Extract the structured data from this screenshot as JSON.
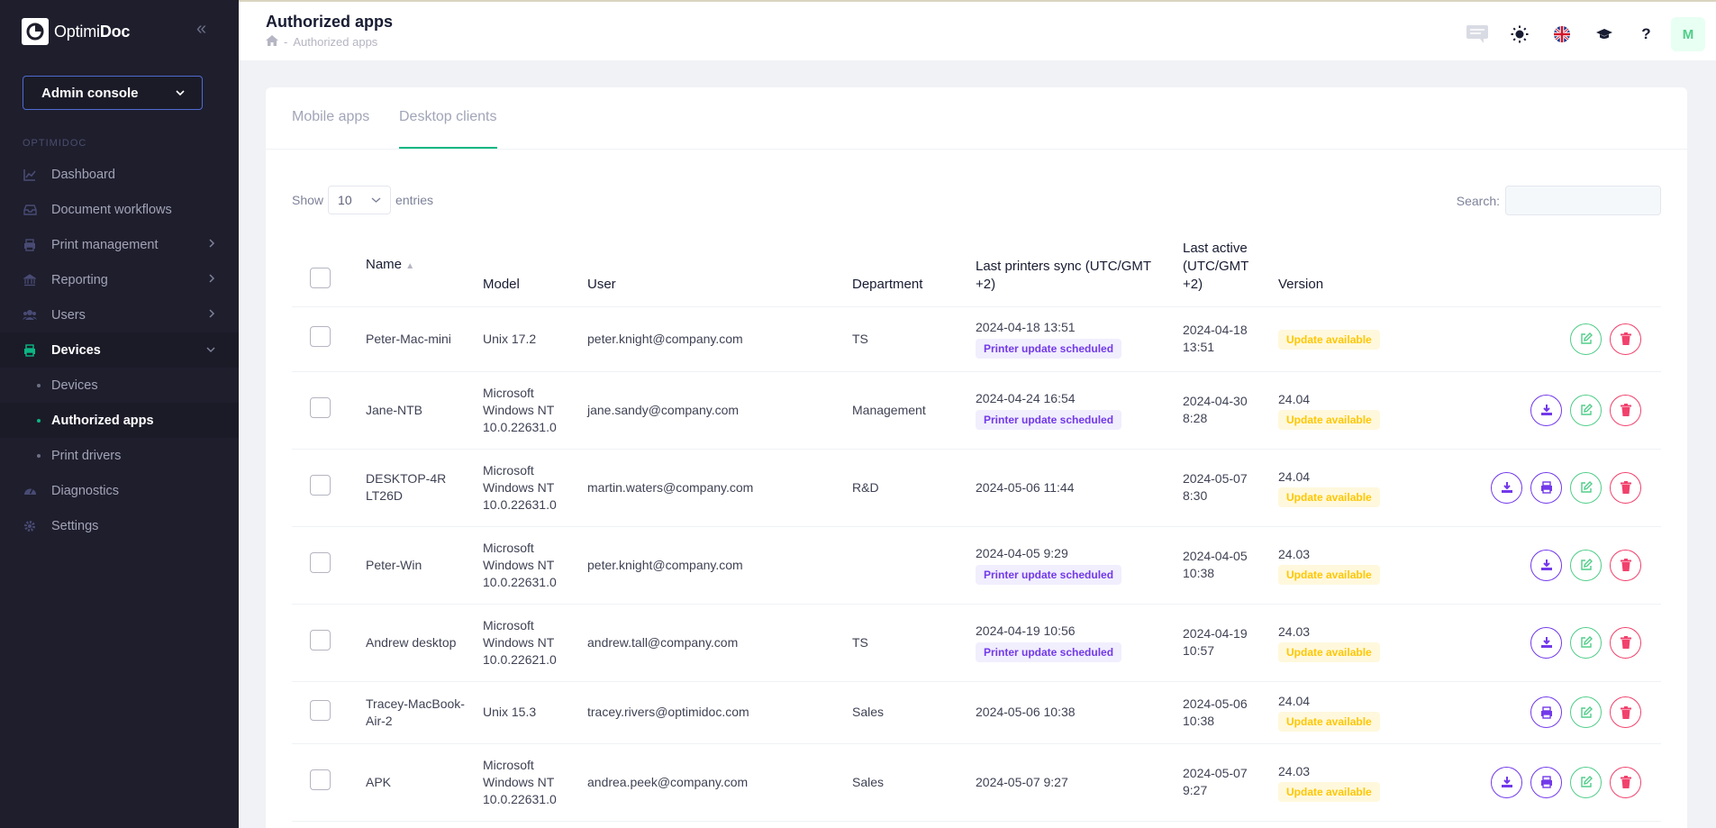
{
  "brand": {
    "name_light": "Optimi",
    "name_bold": "Doc"
  },
  "sidebar": {
    "console_label": "Admin console",
    "section_label": "OPTIMIDOC",
    "items": [
      {
        "label": "Dashboard",
        "icon": "chart-line-icon"
      },
      {
        "label": "Document workflows",
        "icon": "inbox-icon"
      },
      {
        "label": "Print management",
        "icon": "printer-icon"
      },
      {
        "label": "Reporting",
        "icon": "bank-icon"
      },
      {
        "label": "Users",
        "icon": "users-icon"
      },
      {
        "label": "Devices",
        "icon": "printer-icon"
      },
      {
        "label": "Diagnostics",
        "icon": "gauge-icon"
      },
      {
        "label": "Settings",
        "icon": "gear-icon"
      }
    ],
    "sub_items": [
      {
        "label": "Devices"
      },
      {
        "label": "Authorized apps"
      },
      {
        "label": "Print drivers"
      }
    ]
  },
  "header": {
    "title": "Authorized apps",
    "breadcrumb_sep": "-",
    "breadcrumb_current": "Authorized apps",
    "avatar_letter": "M"
  },
  "tabs": [
    {
      "label": "Mobile apps"
    },
    {
      "label": "Desktop clients"
    }
  ],
  "table_controls": {
    "show_label": "Show",
    "entries_value": "10",
    "entries_label": "entries",
    "search_label": "Search:"
  },
  "columns": {
    "name": "Name",
    "model": "Model",
    "user": "User",
    "department": "Department",
    "last_sync": "Last printers sync (UTC/GMT +2)",
    "last_active": "Last active (UTC/GMT +2)",
    "version": "Version"
  },
  "badges": {
    "printer_update": "Printer update scheduled",
    "update_available": "Update available"
  },
  "rows": [
    {
      "name": "Peter-Mac-mini",
      "model": "Unix 17.2",
      "user": "peter.knight@company.com",
      "department": "TS",
      "sync": "2024-04-18 13:51",
      "active": "2024-04-18 13:51",
      "version": ""
    },
    {
      "name": "Jane-NTB",
      "model": "Microsoft Windows NT 10.0.22631.0",
      "user": "jane.sandy@company.com",
      "department": "Management",
      "sync": "2024-04-24 16:54",
      "active": "2024-04-30 8:28",
      "version": "24.04"
    },
    {
      "name": "DESKTOP-4RLT26D",
      "model": "Microsoft Windows NT 10.0.22631.0",
      "user": "martin.waters@company.com",
      "department": "R&D",
      "sync": "2024-05-06 11:44",
      "active": "2024-05-07 8:30",
      "version": "24.04"
    },
    {
      "name": "Peter-Win",
      "model": "Microsoft Windows NT 10.0.22631.0",
      "user": "peter.knight@company.com",
      "department": "",
      "sync": "2024-04-05 9:29",
      "active": "2024-04-05 10:38",
      "version": "24.03"
    },
    {
      "name": "Andrew desktop",
      "model": "Microsoft Windows NT 10.0.22621.0",
      "user": "andrew.tall@company.com",
      "department": "TS",
      "sync": "2024-04-19 10:56",
      "active": "2024-04-19 10:57",
      "version": "24.03"
    },
    {
      "name": "Tracey-MacBook-Air-2",
      "model": "Unix 15.3",
      "user": "tracey.rivers@optimidoc.com",
      "department": "Sales",
      "sync": "2024-05-06 10:38",
      "active": "2024-05-06 10:38",
      "version": "24.04"
    },
    {
      "name": "APK",
      "model": "Microsoft Windows NT 10.0.22631.0",
      "user": "andrea.peek@company.com",
      "department": "Sales",
      "sync": "2024-05-07 9:27",
      "active": "2024-05-07 9:27",
      "version": "24.03"
    }
  ]
}
